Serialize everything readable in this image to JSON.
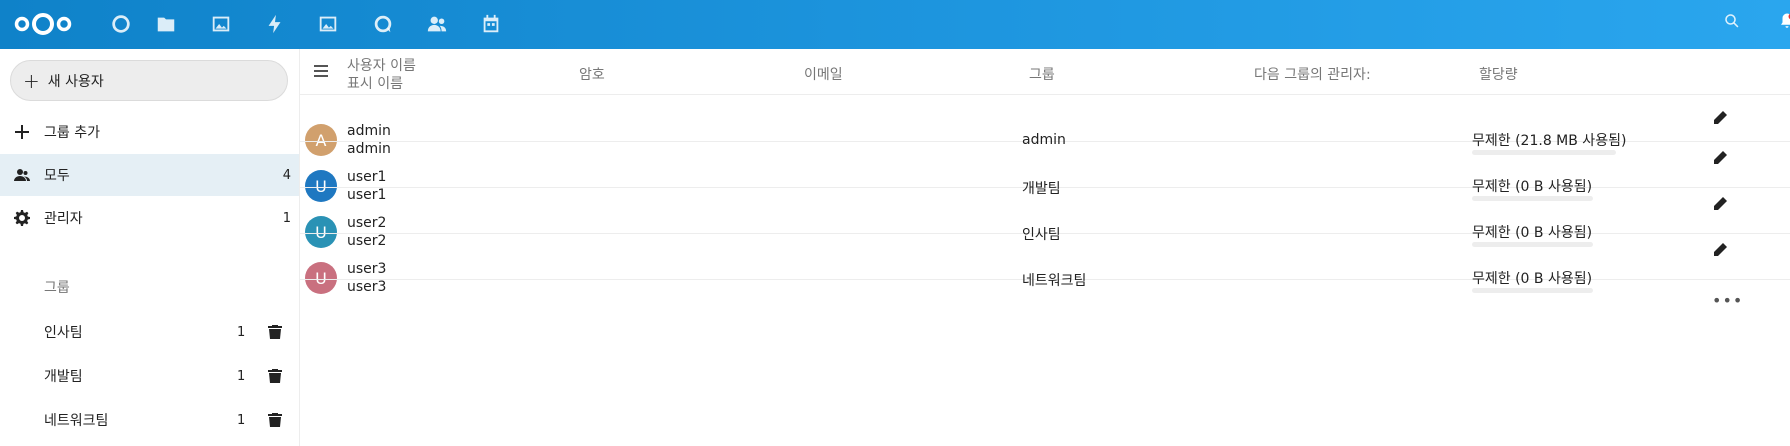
{
  "header": {
    "apps": [
      "dashboard-icon",
      "files-icon",
      "photos-icon",
      "activity-icon",
      "gallery-icon",
      "talk-icon",
      "contacts-icon",
      "calendar-icon"
    ],
    "right": [
      "search-icon",
      "notifications-icon"
    ]
  },
  "sidebar": {
    "new_user_label": "새 사용자",
    "add_group_label": "그룹 추가",
    "everyone": {
      "label": "모두",
      "count": "4"
    },
    "admins": {
      "label": "관리자",
      "count": "1"
    },
    "groups_caption": "그룹",
    "groups": [
      {
        "label": "인사팀",
        "count": "1"
      },
      {
        "label": "개발팀",
        "count": "1"
      },
      {
        "label": "네트워크팀",
        "count": "1"
      }
    ]
  },
  "table": {
    "headers": {
      "username": "사용자 이름",
      "displayname": "표시 이름",
      "password": "암호",
      "email": "이메일",
      "groups": "그룹",
      "subadmin": "다음 그룹의 관리자:",
      "quota": "할당량"
    },
    "rows": [
      {
        "initial": "A",
        "avatar_color": "#d1a06d",
        "username": "admin",
        "displayname": "admin",
        "group": "admin",
        "quota": "무제한 (21.8 MB 사용됨)"
      },
      {
        "initial": "U",
        "avatar_color": "#1f78c1",
        "username": "user1",
        "displayname": "user1",
        "group": "개발팀",
        "quota": "무제한 (0 B 사용됨)"
      },
      {
        "initial": "U",
        "avatar_color": "#2a92b5",
        "username": "user2",
        "displayname": "user2",
        "group": "인사팀",
        "quota": "무제한 (0 B 사용됨)"
      },
      {
        "initial": "U",
        "avatar_color": "#c9707f",
        "username": "user3",
        "displayname": "user3",
        "group": "네트워크팀",
        "quota": "무제한 (0 B 사용됨)"
      }
    ]
  }
}
